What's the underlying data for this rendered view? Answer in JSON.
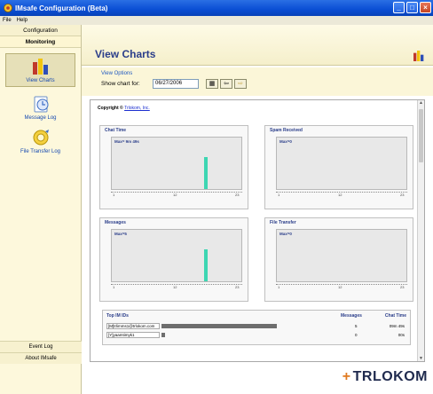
{
  "window": {
    "title": "IMsafe Configuration (Beta)"
  },
  "menu": {
    "file": "File",
    "help": "Help"
  },
  "sidebar": {
    "configuration": "Configuration",
    "monitoring": "Monitoring",
    "items": [
      {
        "label": "View Charts",
        "icon": "chart-icon"
      },
      {
        "label": "Message Log",
        "icon": "message-log-icon"
      },
      {
        "label": "File Transfer Log",
        "icon": "file-transfer-icon"
      }
    ],
    "event_log": "Event Log",
    "about": "About IMsafe"
  },
  "header": {
    "title": "View Charts"
  },
  "options": {
    "group_label": "View Options",
    "show_chart_for": "Show chart for:",
    "date": "06/27/2006",
    "btn_calendar": "▦",
    "btn_prev": "⇦",
    "btn_next": "⇨"
  },
  "content": {
    "copyright_prefix": "Copyright © ",
    "copyright_link": "Trlokom, Inc."
  },
  "chart_data": [
    {
      "type": "bar",
      "title": "Chat Time",
      "max_label": "Max= 9m 49s",
      "ticks": [
        "1",
        "12",
        "23"
      ],
      "values": [
        0,
        0,
        0,
        0,
        0,
        0,
        0,
        0,
        0,
        0,
        0,
        0,
        0,
        0,
        0,
        0,
        1,
        0,
        0,
        0,
        0,
        0,
        0
      ]
    },
    {
      "type": "bar",
      "title": "Spam Received",
      "max_label": "Max=0",
      "ticks": [
        "1",
        "12",
        "23"
      ],
      "values": [
        0,
        0,
        0,
        0,
        0,
        0,
        0,
        0,
        0,
        0,
        0,
        0,
        0,
        0,
        0,
        0,
        0,
        0,
        0,
        0,
        0,
        0,
        0
      ]
    },
    {
      "type": "bar",
      "title": "Messages",
      "max_label": "Max=5",
      "ticks": [
        "1",
        "12",
        "23"
      ],
      "values": [
        0,
        0,
        0,
        0,
        0,
        0,
        0,
        0,
        0,
        0,
        0,
        0,
        0,
        0,
        0,
        0,
        5,
        0,
        0,
        0,
        0,
        0,
        0
      ]
    },
    {
      "type": "bar",
      "title": "File Transfer",
      "max_label": "Max=0",
      "ticks": [
        "1",
        "12",
        "23"
      ],
      "values": [
        0,
        0,
        0,
        0,
        0,
        0,
        0,
        0,
        0,
        0,
        0,
        0,
        0,
        0,
        0,
        0,
        0,
        0,
        0,
        0,
        0,
        0,
        0
      ]
    }
  ],
  "top_ids": {
    "title": "Top IM IDs",
    "col_messages": "Messages",
    "col_chat_time": "Chat Time",
    "rows": [
      {
        "id": "[M]trlimms1@trlokom.com",
        "messages": "5",
        "chat_time": "09m 49s",
        "share": 0.65
      },
      {
        "id": "[Y]yaamtimyk1",
        "messages": "0",
        "chat_time": "00s",
        "share": 0.02
      }
    ]
  },
  "footer": {
    "logo": "TRLOKOM"
  },
  "colors": {
    "accent": "#2b3e8a",
    "bar": "#3dd6b2",
    "sidebar_bg": "#fdf8dc"
  }
}
